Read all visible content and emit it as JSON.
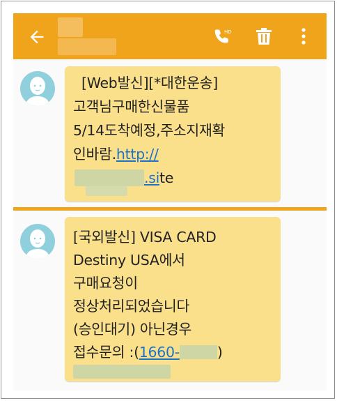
{
  "toolbar": {
    "back_icon": "arrow-left-icon",
    "call_icon": "call-icon",
    "delete_icon": "trash-icon",
    "more_icon": "more-vertical-icon",
    "accent_color": "#efa41c"
  },
  "messages": [
    {
      "lines": [
        "[Web발신][*대한운송]",
        "고객님구매한신물품",
        "5/14도착예정,주소지재확",
        "인바람."
      ],
      "link_text": "http://",
      "link_suffix_link": ".si",
      "link_suffix_plain": "te"
    },
    {
      "lines": [
        "[국외발신] VISA CARD",
        "Destiny USA에서",
        "구매요청이",
        "정상처리되었습니다",
        "(승인대기) 아닌경우"
      ],
      "contact_prefix": "접수문의 :(",
      "contact_link": "1660-",
      "contact_suffix": ")"
    }
  ],
  "colors": {
    "bubble": "#fbe08c",
    "link": "#1a73c8",
    "avatar": "#8fd0dc"
  }
}
